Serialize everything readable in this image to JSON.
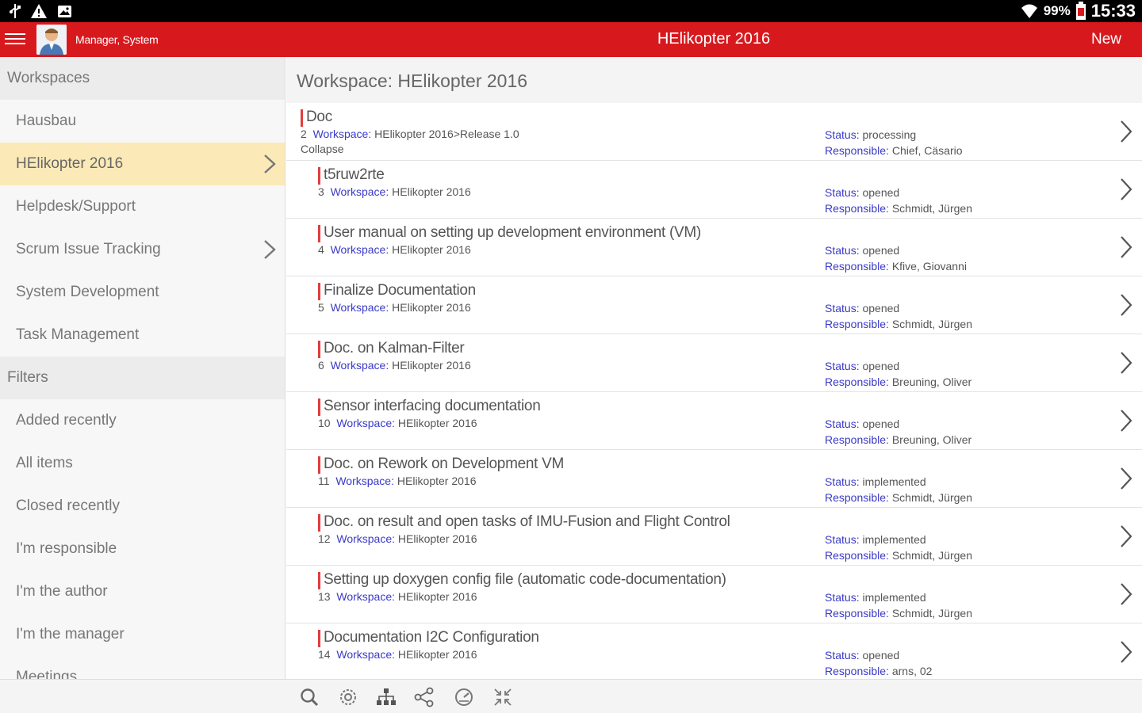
{
  "statusbar": {
    "icons": [
      "usb-icon",
      "warning-icon",
      "image-icon"
    ],
    "battery": "99%",
    "time": "15:33"
  },
  "header": {
    "user": "Manager, System",
    "title": "HElikopter 2016",
    "new_label": "New",
    "accent": "#d7191e"
  },
  "sidebar": {
    "workspaces_heading": "Workspaces",
    "workspaces": [
      {
        "label": "Hausbau"
      },
      {
        "label": "HElikopter 2016"
      },
      {
        "label": "Helpdesk/Support"
      },
      {
        "label": "Scrum Issue Tracking"
      },
      {
        "label": "System Development"
      },
      {
        "label": "Task Management"
      }
    ],
    "filters_heading": "Filters",
    "filters": [
      {
        "label": "Added recently"
      },
      {
        "label": "All items"
      },
      {
        "label": "Closed recently"
      },
      {
        "label": "I'm responsible"
      },
      {
        "label": "I'm the author"
      },
      {
        "label": "I'm the manager"
      },
      {
        "label": "Meetings"
      }
    ]
  },
  "main": {
    "heading": "Workspace: HElikopter 2016",
    "workspace_key": "Workspace:",
    "status_key": "Status:",
    "responsible_key": "Responsible:",
    "items": [
      {
        "title": "Doc",
        "num": "2",
        "workspace": "HElikopter 2016>Release 1.0",
        "extra": "Collapse",
        "status": "processing",
        "responsible": "Chief, Cäsario"
      },
      {
        "title": "t5ruw2rte",
        "num": "3",
        "workspace": "HElikopter 2016",
        "status": "opened",
        "responsible": "Schmidt, Jürgen"
      },
      {
        "title": "User manual on setting up development environment (VM)",
        "num": "4",
        "workspace": "HElikopter 2016",
        "status": "opened",
        "responsible": "Kfive, Giovanni"
      },
      {
        "title": "Finalize Documentation",
        "num": "5",
        "workspace": "HElikopter 2016",
        "status": "opened",
        "responsible": "Schmidt, Jürgen"
      },
      {
        "title": "Doc. on Kalman-Filter",
        "num": "6",
        "workspace": "HElikopter 2016",
        "status": "opened",
        "responsible": "Breuning, Oliver"
      },
      {
        "title": "Sensor interfacing documentation",
        "num": "10",
        "workspace": "HElikopter 2016",
        "status": "opened",
        "responsible": "Breuning, Oliver"
      },
      {
        "title": "Doc. on Rework on Development VM",
        "num": "11",
        "workspace": "HElikopter 2016",
        "status": "implemented",
        "responsible": "Schmidt, Jürgen"
      },
      {
        "title": "Doc. on result and open tasks of IMU-Fusion and Flight Control",
        "num": "12",
        "workspace": "HElikopter 2016",
        "status": "implemented",
        "responsible": "Schmidt, Jürgen"
      },
      {
        "title": "Setting up doxygen config file (automatic code-documentation)",
        "num": "13",
        "workspace": "HElikopter 2016",
        "status": "implemented",
        "responsible": "Schmidt, Jürgen"
      },
      {
        "title": "Documentation I2C Configuration",
        "num": "14",
        "workspace": "HElikopter 2016",
        "status": "opened",
        "responsible": "arns, 02"
      }
    ]
  },
  "toolbar": {
    "icons": [
      "search-icon",
      "settings-icon",
      "hierarchy-icon",
      "share-icon",
      "dashboard-icon",
      "collapse-icon"
    ]
  }
}
